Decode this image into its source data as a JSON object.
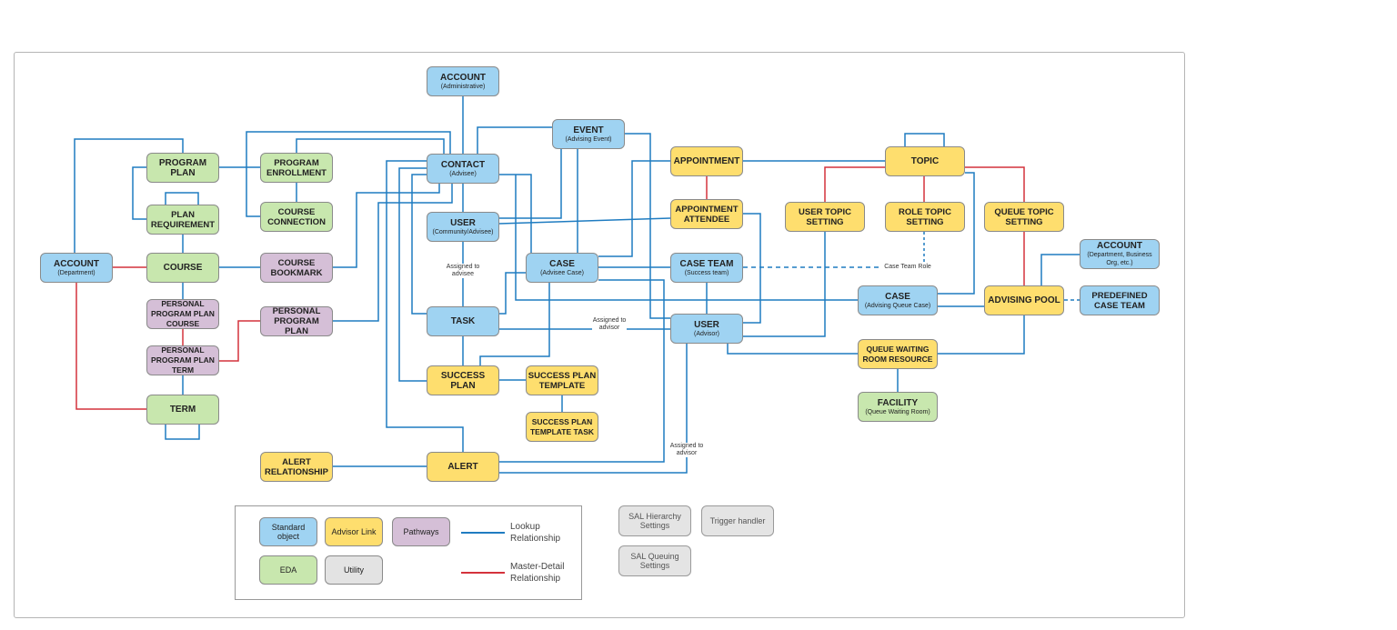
{
  "colors": {
    "standard_object": "#9fd3f2",
    "advisor_link": "#fede6e",
    "eda": "#c8e7ae",
    "pathways": "#d5bfd7",
    "utility": "#e3e3e3",
    "lookup_line": "#1f7cc1",
    "master_detail_line": "#d4323c"
  },
  "nodes": [
    {
      "id": "account_admin",
      "title": "ACCOUNT",
      "subtitle": "(Administrative)",
      "category": "standard"
    },
    {
      "id": "contact",
      "title": "CONTACT",
      "subtitle": "(Advisee)",
      "category": "standard"
    },
    {
      "id": "user_comm",
      "title": "USER",
      "subtitle": "(Community/Advisee)",
      "category": "standard"
    },
    {
      "id": "task",
      "title": "TASK",
      "subtitle": "",
      "category": "standard"
    },
    {
      "id": "success_plan",
      "title": "SUCCESS PLAN",
      "subtitle": "",
      "category": "advisor"
    },
    {
      "id": "alert",
      "title": "ALERT",
      "subtitle": "",
      "category": "advisor"
    },
    {
      "id": "alert_rel",
      "title": "ALERT RELATIONSHIP",
      "subtitle": "",
      "category": "advisor"
    },
    {
      "id": "sp_template",
      "title": "SUCCESS PLAN TEMPLATE",
      "subtitle": "",
      "category": "advisor"
    },
    {
      "id": "sp_template_task",
      "title": "SUCCESS PLAN TEMPLATE TASK",
      "subtitle": "",
      "category": "advisor"
    },
    {
      "id": "case_advisee",
      "title": "CASE",
      "subtitle": "(Advisee Case)",
      "category": "standard"
    },
    {
      "id": "event",
      "title": "EVENT",
      "subtitle": "(Advising Event)",
      "category": "standard"
    },
    {
      "id": "appointment",
      "title": "APPOINTMENT",
      "subtitle": "",
      "category": "advisor"
    },
    {
      "id": "appt_attendee",
      "title": "APPOINTMENT ATTENDEE",
      "subtitle": "",
      "category": "advisor"
    },
    {
      "id": "case_team",
      "title": "CASE TEAM",
      "subtitle": "(Success team)",
      "category": "standard"
    },
    {
      "id": "user_advisor",
      "title": "USER",
      "subtitle": "(Advisor)",
      "category": "standard"
    },
    {
      "id": "topic",
      "title": "TOPIC",
      "subtitle": "",
      "category": "advisor"
    },
    {
      "id": "user_topic",
      "title": "USER TOPIC SETTING",
      "subtitle": "",
      "category": "advisor"
    },
    {
      "id": "role_topic",
      "title": "ROLE TOPIC SETTING",
      "subtitle": "",
      "category": "advisor"
    },
    {
      "id": "queue_topic",
      "title": "QUEUE TOPIC SETTING",
      "subtitle": "",
      "category": "advisor"
    },
    {
      "id": "case_queue",
      "title": "CASE",
      "subtitle": "(Advising Queue Case)",
      "category": "standard"
    },
    {
      "id": "advising_pool",
      "title": "ADVISING POOL",
      "subtitle": "",
      "category": "advisor"
    },
    {
      "id": "account_org",
      "title": "ACCOUNT",
      "subtitle": "(Department, Business Org, etc.)",
      "category": "standard"
    },
    {
      "id": "predefined",
      "title": "PREDEFINED CASE TEAM",
      "subtitle": "",
      "category": "standard"
    },
    {
      "id": "qwr",
      "title": "QUEUE WAITING ROOM RESOURCE",
      "subtitle": "",
      "category": "advisor"
    },
    {
      "id": "facility",
      "title": "FACILITY",
      "subtitle": "(Queue Waiting Room)",
      "category": "eda"
    },
    {
      "id": "program_plan",
      "title": "PROGRAM PLAN",
      "subtitle": "",
      "category": "eda"
    },
    {
      "id": "plan_req",
      "title": "PLAN REQUIREMENT",
      "subtitle": "",
      "category": "eda"
    },
    {
      "id": "course",
      "title": "COURSE",
      "subtitle": "",
      "category": "eda"
    },
    {
      "id": "ppp_course",
      "title": "PERSONAL PROGRAM PLAN COURSE",
      "subtitle": "",
      "category": "pathways"
    },
    {
      "id": "ppp_term",
      "title": "PERSONAL PROGRAM PLAN TERM",
      "subtitle": "",
      "category": "pathways"
    },
    {
      "id": "term",
      "title": "TERM",
      "subtitle": "",
      "category": "eda"
    },
    {
      "id": "account_dept",
      "title": "ACCOUNT",
      "subtitle": "(Department)",
      "category": "standard"
    },
    {
      "id": "program_enrollment",
      "title": "PROGRAM ENROLLMENT",
      "subtitle": "",
      "category": "eda"
    },
    {
      "id": "course_conn",
      "title": "COURSE CONNECTION",
      "subtitle": "",
      "category": "eda"
    },
    {
      "id": "course_bookmark",
      "title": "COURSE BOOKMARK",
      "subtitle": "",
      "category": "pathways"
    },
    {
      "id": "ppp",
      "title": "PERSONAL PROGRAM PLAN",
      "subtitle": "",
      "category": "pathways"
    }
  ],
  "edge_labels": {
    "assigned_advisee": "Assigned to advisee",
    "assigned_advisor_task": "Assigned to advisor",
    "assigned_advisor_alert": "Assigned to advisor",
    "case_team_role": "Case Team Role"
  },
  "legend": {
    "standard": "Standard object",
    "advisor": "Advisor Link",
    "pathways": "Pathways",
    "eda": "EDA",
    "utility": "Utility",
    "lookup": "Lookup Relationship",
    "master_detail": "Master-Detail Relationship"
  },
  "utilities": [
    "SAL Hierarchy Settings",
    "Trigger handler",
    "SAL Queuing Settings"
  ]
}
